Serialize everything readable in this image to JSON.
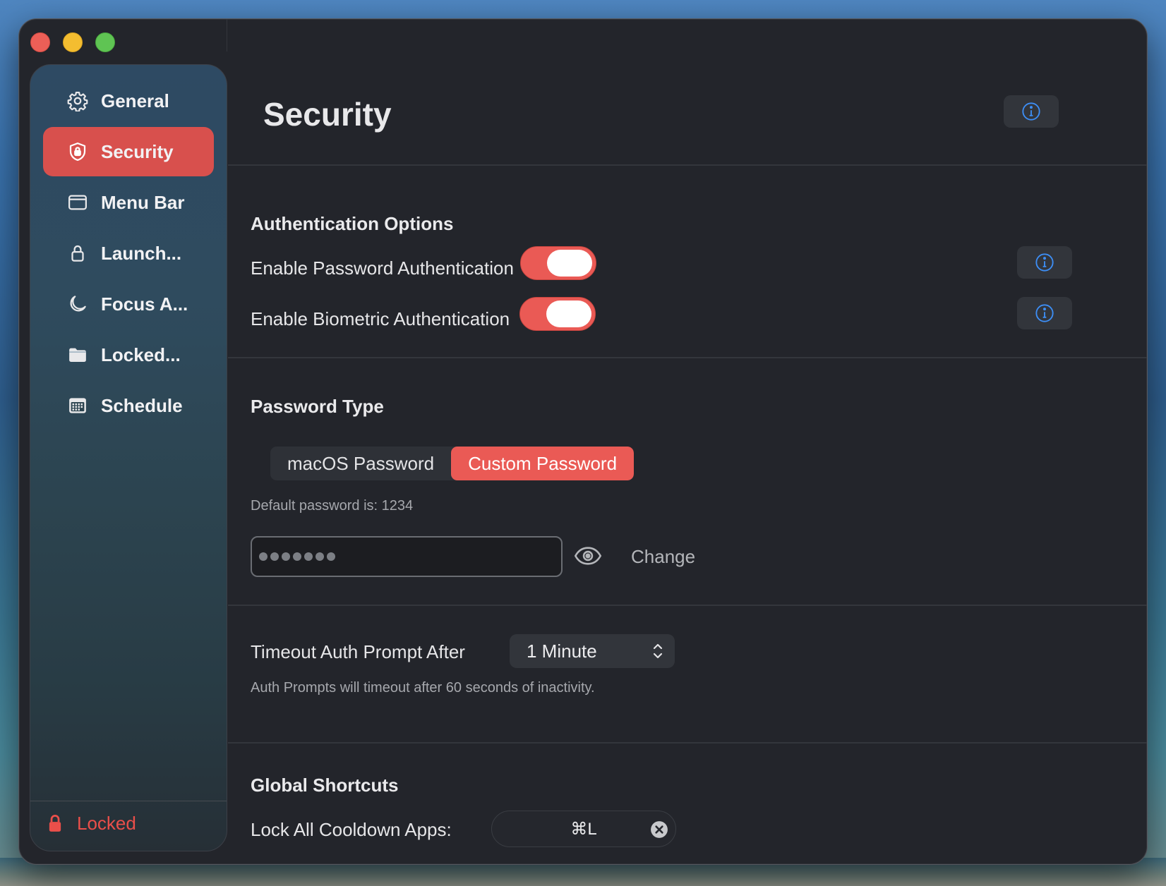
{
  "sidebar": {
    "items": [
      {
        "label": "General",
        "icon": "gear-icon"
      },
      {
        "label": "Security",
        "icon": "shield-icon",
        "active": true
      },
      {
        "label": "Menu Bar",
        "icon": "window-icon"
      },
      {
        "label": "Launch...",
        "icon": "lock-icon"
      },
      {
        "label": "Focus A...",
        "icon": "moon-icon"
      },
      {
        "label": "Locked...",
        "icon": "folder-icon"
      },
      {
        "label": "Schedule",
        "icon": "calendar-icon"
      }
    ],
    "footer_status": "Locked"
  },
  "header": {
    "title": "Security"
  },
  "auth_options": {
    "title": "Authentication Options",
    "password_auth_label": "Enable Password Authentication",
    "password_auth_enabled": true,
    "biometric_auth_label": "Enable Biometric Authentication",
    "biometric_auth_enabled": true
  },
  "password_type": {
    "title": "Password Type",
    "options": [
      "macOS Password",
      "Custom Password"
    ],
    "selected": "Custom Password",
    "default_hint": "Default password is: 1234",
    "masked_length": 7,
    "change_label": "Change"
  },
  "timeout": {
    "label": "Timeout Auth Prompt After",
    "value": "1 Minute",
    "hint": "Auth Prompts will timeout after 60 seconds of inactivity."
  },
  "shortcuts": {
    "title": "Global Shortcuts",
    "lock_all_label": "Lock All Cooldown Apps:",
    "lock_all_value": "⌘L"
  },
  "colors": {
    "accent": "#ea5a55",
    "info_blue": "#3d8ef5",
    "locked_red": "#ea4f4a"
  }
}
